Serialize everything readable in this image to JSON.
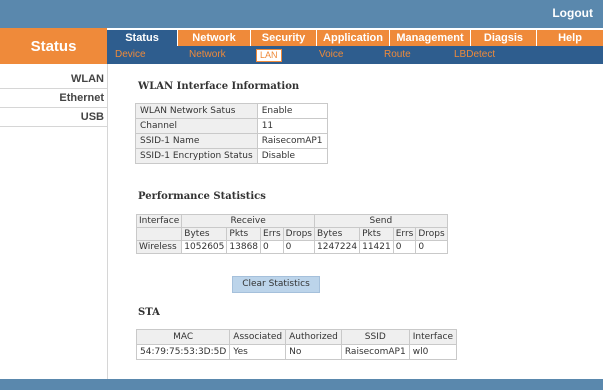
{
  "header": {
    "logout_label": "Logout"
  },
  "section_title": "Status",
  "main_tabs": [
    {
      "label": "Status"
    },
    {
      "label": "Network"
    },
    {
      "label": "Security"
    },
    {
      "label": "Application"
    },
    {
      "label": "Management"
    },
    {
      "label": "Diagsis"
    },
    {
      "label": "Help"
    }
  ],
  "sub_tabs": [
    {
      "label": "Device"
    },
    {
      "label": "Network"
    },
    {
      "label": "LAN",
      "active": true
    },
    {
      "label": "Voice"
    },
    {
      "label": "Route"
    },
    {
      "label": "LBDetect"
    }
  ],
  "sidebar": {
    "items": [
      {
        "label": "WLAN"
      },
      {
        "label": "Ethernet"
      },
      {
        "label": "USB"
      }
    ]
  },
  "wlan_info": {
    "title": "WLAN Interface Information",
    "rows": [
      {
        "label": "WLAN Network Satus",
        "value": "Enable"
      },
      {
        "label": "Channel",
        "value": "11"
      },
      {
        "label": "SSID-1 Name",
        "value": "RaisecomAP1"
      },
      {
        "label": "SSID-1 Encryption Status",
        "value": "Disable"
      }
    ]
  },
  "performance": {
    "title": "Performance Statistics",
    "interface_header": "Interface",
    "receive_header": "Receive",
    "send_header": "Send",
    "columns": [
      "Bytes",
      "Pkts",
      "Errs",
      "Drops",
      "Bytes",
      "Pkts",
      "Errs",
      "Drops"
    ],
    "row": {
      "interface": "Wireless",
      "values": [
        "1052605",
        "13868",
        "0",
        "0",
        "1247224",
        "11421",
        "0",
        "0"
      ]
    }
  },
  "clear_button_label": "Clear Statistics",
  "sta": {
    "title": "STA",
    "columns": [
      "MAC",
      "Associated",
      "Authorized",
      "SSID",
      "Interface"
    ],
    "row": [
      "54:79:75:53:3D:5D",
      "Yes",
      "No",
      "RaisecomAP1",
      "wl0"
    ]
  },
  "colors": {
    "top_bar": "#5a88ad",
    "nav_blue": "#2e5d8e",
    "accent_orange": "#ef8a3a",
    "button_blue": "#bcd4ea"
  }
}
